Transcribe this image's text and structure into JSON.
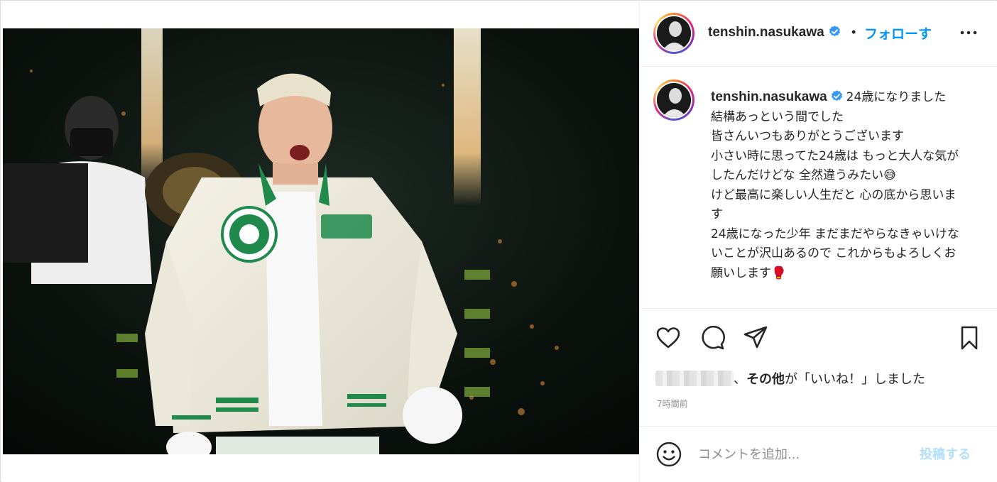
{
  "post": {
    "username": "tenshin.nasukawa",
    "verified": true,
    "separator": "•",
    "follow_label": "フォローす",
    "more_icon": "more-horizontal-icon",
    "image_alt": "photo"
  },
  "caption": {
    "username": "tenshin.nasukawa",
    "lines": [
      "24歳になりました",
      "結構あっという間でした",
      "皆さんいつもありがとうございます",
      "小さい時に思ってた24歳は もっと大人な気がしたんだけどな 全然違うみたい😅",
      "けど最高に楽しい人生だと 心の底から思います",
      "24歳になった少年 まだまだやらなきゃいけないことが沢山あるので これからもよろしくお願いします🥊"
    ]
  },
  "actions": {
    "icons": [
      "heart-icon",
      "comment-icon",
      "share-icon",
      "bookmark-icon"
    ],
    "likes_suffix": "、",
    "likes_bold": "その他",
    "likes_text": "が「いいね！」しました",
    "timestamp": "7時間前"
  },
  "comment": {
    "placeholder": "コメントを追加...",
    "post_label": "投稿する",
    "emoji_icon": "smiley-icon"
  },
  "colors": {
    "accent": "#0095f6",
    "verified_badge": "#3897f0",
    "post_disabled": "#b2dffc",
    "jacket_green": "#1f8a4c",
    "jacket_cream": "#f2efe4"
  }
}
